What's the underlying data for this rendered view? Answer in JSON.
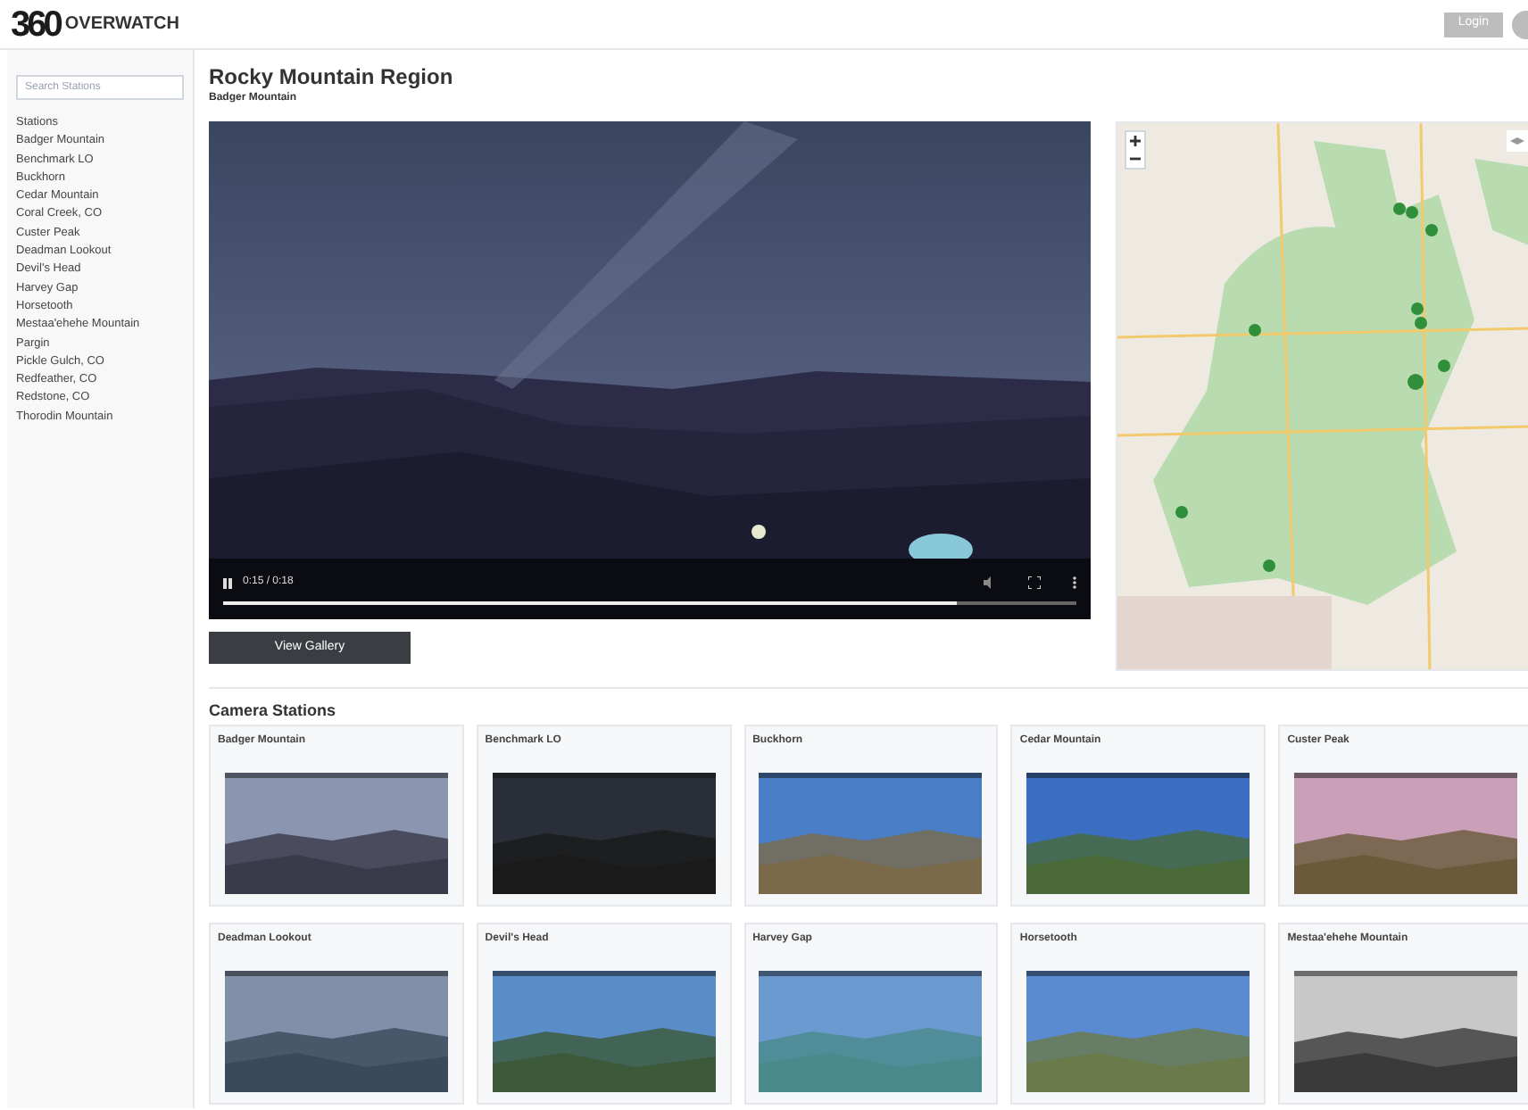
{
  "header": {
    "logo": {
      "mark": "360",
      "name": "OVERWATCH"
    },
    "login_button": "Login"
  },
  "sidebar": {
    "search": {
      "placeholder": "Search Stations"
    },
    "heading": "Stations",
    "items": [
      {
        "label": "Badger Mountain"
      },
      {
        "label": "Benchmark LO"
      },
      {
        "label": "Buckhorn"
      },
      {
        "label": "Cedar Mountain"
      },
      {
        "label": "Coral Creek, CO"
      },
      {
        "label": "Custer Peak"
      },
      {
        "label": "Deadman Lookout"
      },
      {
        "label": "Devil's Head"
      },
      {
        "label": "Harvey Gap"
      },
      {
        "label": "Horsetooth"
      },
      {
        "label": "Mestaa'ehehe Mountain"
      },
      {
        "label": "Pargin"
      },
      {
        "label": "Pickle Gulch, CO"
      },
      {
        "label": "Redfeather, CO"
      },
      {
        "label": "Redstone, CO"
      },
      {
        "label": "Thorodin Mountain"
      }
    ]
  },
  "region": {
    "title": "Rocky Mountain Region",
    "subtitle": "Badger Mountain"
  },
  "video": {
    "time": "0:15 / 0:18",
    "progress": {
      "level": 0.86
    }
  },
  "gallery_button": "View Gallery",
  "camera_stations": {
    "title": "Camera Stations",
    "cards": [
      {
        "title": "Badger Mountain"
      },
      {
        "title": "Benchmark LO"
      },
      {
        "title": "Buckhorn"
      },
      {
        "title": "Cedar Mountain"
      },
      {
        "title": "Custer Peak"
      },
      {
        "title": "Deadman Lookout"
      },
      {
        "title": "Devil's Head"
      },
      {
        "title": "Harvey Gap"
      },
      {
        "title": "Horsetooth"
      },
      {
        "title": "Mestaa'ehehe Mountain"
      }
    ]
  }
}
